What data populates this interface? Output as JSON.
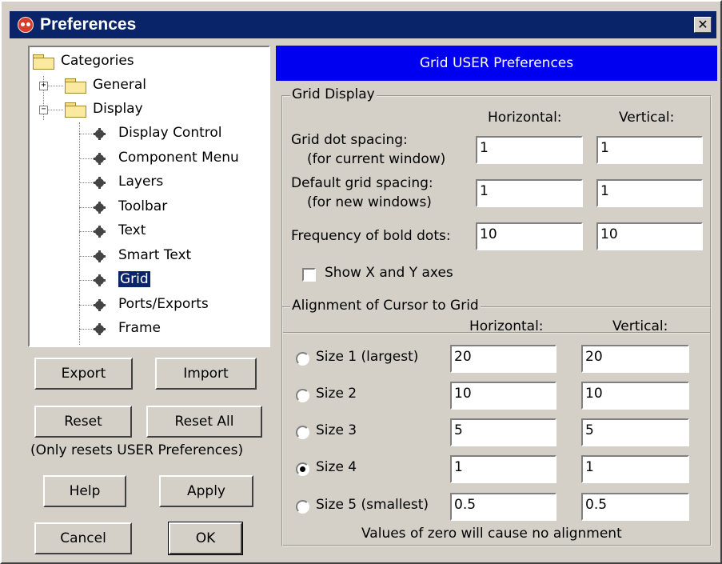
{
  "window": {
    "title": "Preferences",
    "close_glyph": "✕"
  },
  "tree": {
    "root": "Categories",
    "general": "General",
    "display": "Display",
    "expand_glyph": "+",
    "collapse_glyph": "−",
    "items": [
      "Display Control",
      "Component Menu",
      "Layers",
      "Toolbar",
      "Text",
      "Smart Text",
      "Grid",
      "Ports/Exports",
      "Frame"
    ],
    "selected": "Grid"
  },
  "buttons": {
    "export": "Export",
    "import": "Import",
    "reset": "Reset",
    "reset_all": "Reset All",
    "reset_note": "(Only resets USER Preferences)",
    "help": "Help",
    "apply": "Apply",
    "cancel": "Cancel",
    "ok": "OK"
  },
  "panel": {
    "title": "Grid USER Preferences"
  },
  "grid_display": {
    "legend": "Grid Display",
    "col_horizontal": "Horizontal:",
    "col_vertical": "Vertical:",
    "dot_spacing_label": "Grid dot spacing:",
    "dot_spacing_sub": "(for current window)",
    "dot_spacing_h": "1",
    "dot_spacing_v": "1",
    "default_spacing_label": "Default grid spacing:",
    "default_spacing_sub": "(for new windows)",
    "default_spacing_h": "1",
    "default_spacing_v": "1",
    "bold_freq_label": "Frequency of bold dots:",
    "bold_freq_h": "10",
    "bold_freq_v": "10",
    "show_axes_label": "Show X and Y axes",
    "show_axes_checked": false
  },
  "alignment": {
    "legend": "Alignment of Cursor to Grid",
    "col_horizontal": "Horizontal:",
    "col_vertical": "Vertical:",
    "sizes": [
      {
        "label": "Size 1 (largest)",
        "h": "20",
        "v": "20",
        "selected": false
      },
      {
        "label": "Size 2",
        "h": "10",
        "v": "10",
        "selected": false
      },
      {
        "label": "Size 3",
        "h": "5",
        "v": "5",
        "selected": false
      },
      {
        "label": "Size 4",
        "h": "1",
        "v": "1",
        "selected": true
      },
      {
        "label": "Size 5 (smallest)",
        "h": "0.5",
        "v": "0.5",
        "selected": false
      }
    ],
    "note": "Values of zero will cause no alignment"
  }
}
